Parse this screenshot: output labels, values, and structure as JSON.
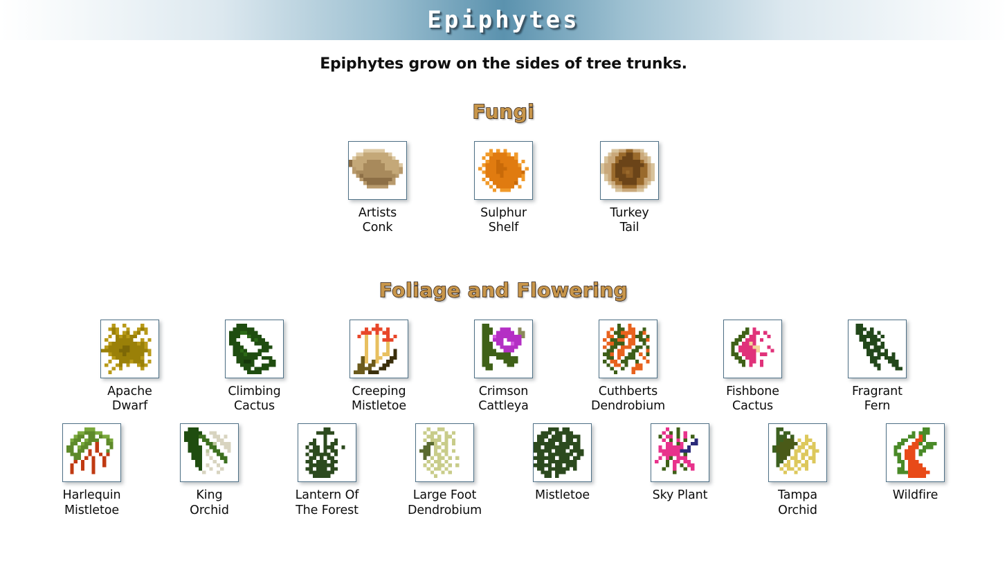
{
  "banner": {
    "title": "Epiphytes"
  },
  "subtitle": "Epiphytes grow on the sides of tree trunks.",
  "colors": {
    "banner_center": "#5b92ae",
    "banner_edge": "#ffffff",
    "heading_fill": "#c8964b",
    "heading_outline": "#201008",
    "icon_box_border": "#4d6f85",
    "icon_box_bg": "#ffffff",
    "label_text": "#0b0b0b"
  },
  "sections": [
    {
      "id": "fungi",
      "heading": "Fungi",
      "rows": [
        [
          {
            "label": "Artists\nConk",
            "icon": "artists-conk-icon"
          },
          {
            "label": "Sulphur\nShelf",
            "icon": "sulphur-shelf-icon"
          },
          {
            "label": "Turkey\nTail",
            "icon": "turkey-tail-icon"
          }
        ]
      ]
    },
    {
      "id": "foliage",
      "heading": "Foliage and Flowering",
      "rows": [
        [
          {
            "label": "Apache\nDwarf",
            "icon": "apache-dwarf-icon"
          },
          {
            "label": "Climbing\nCactus",
            "icon": "climbing-cactus-icon"
          },
          {
            "label": "Creeping\nMistletoe",
            "icon": "creeping-mistletoe-icon"
          },
          {
            "label": "Crimson\nCattleya",
            "icon": "crimson-cattleya-icon"
          },
          {
            "label": "Cuthberts\nDendrobium",
            "icon": "cuthberts-dendrobium-icon"
          },
          {
            "label": "Fishbone\nCactus",
            "icon": "fishbone-cactus-icon"
          },
          {
            "label": "Fragrant\nFern",
            "icon": "fragrant-fern-icon"
          }
        ],
        [
          {
            "label": "Harlequin\nMistletoe",
            "icon": "harlequin-mistletoe-icon"
          },
          {
            "label": "King\nOrchid",
            "icon": "king-orchid-icon"
          },
          {
            "label": "Lantern Of\nThe Forest",
            "icon": "lantern-of-the-forest-icon"
          },
          {
            "label": "Large Foot\nDendrobium",
            "icon": "large-foot-dendrobium-icon"
          },
          {
            "label": "Mistletoe",
            "icon": "mistletoe-icon"
          },
          {
            "label": "Sky Plant",
            "icon": "sky-plant-icon"
          },
          {
            "label": "Tampa\nOrchid",
            "icon": "tampa-orchid-icon"
          },
          {
            "label": "Wildfire",
            "icon": "wildfire-icon"
          }
        ]
      ]
    }
  ],
  "icon_art": {
    "artists-conk-icon": {
      "palette": {
        "a": "#c4a878",
        "b": "#a88a5c",
        "c": "#8d6f46",
        "d": "#ddc9a3",
        "e": "#b89a6c"
      },
      "rows": [
        "................",
        "................",
        "....dddddd......",
        "..ddaaaaaaad....",
        ".daaaaaaaaaad...",
        "caaaabbbbaaaaa..",
        "caaabbbbbbaaaad.",
        ".eaabbbbbbaaaae.",
        ".ebbbbbbbbbbaae.",
        "..ecbbbbbbbbbe..",
        "...ecccccccce...",
        "....eccccccee...",
        ".....eeeeee.....",
        "................",
        "................",
        "................"
      ]
    },
    "sulphur-shelf-icon": {
      "palette": {
        "o": "#e07b10",
        "p": "#f19a2a",
        "q": "#c96a08",
        "r": "#f6b860"
      },
      "rows": [
        "................",
        "................",
        "....p.p.p.......",
        "...ppoooop.p....",
        "..p.ooooooop....",
        "...pooqooooo.p..",
        "..poooqqoooop...",
        ".p.oooqqqoooo.p.",
        "..poooqqoooooq..",
        "...ooooqooooop..",
        "..p.oooooooo.p..",
        "...p.ooooooq....",
        "....p.ooooo.p...",
        ".....p.ppp......",
        "................",
        "................"
      ]
    },
    "turkey-tail-icon": {
      "palette": {
        "a": "#c9a87a",
        "b": "#9a6a2c",
        "c": "#6b4418",
        "d": "#d8c39c",
        "e": "#8a5a22"
      },
      "rows": [
        "................",
        "................",
        "...ddaabbaad....",
        "..daabbccbbad...",
        ".daabbcccbbaad..",
        ".daabccccccbad..",
        "daabccccccccbad.",
        "daabcceeeccbbad.",
        "daabccebeccbbad.",
        ".dabccceeccbbad.",
        ".dabbcccccbbaad.",
        "..dabbccccbbad..",
        "...daabbbbaad...",
        "....ddaaaadd....",
        "................",
        "................"
      ]
    },
    "apache-dwarf-icon": {
      "palette": {
        "y": "#9a8008",
        "z": "#b89a18",
        "w": "#7d6806"
      },
      "rows": [
        "................",
        "...z..z....z....",
        "..zyz..z..zyz...",
        "...yz.zy.zy.z...",
        "..z.yzyzyy......",
        ".z..yyyyy..z.z..",
        "..zyyyyyyyzyz...",
        ".zyyyywwyyyyz...",
        "yyyyywwwyyyyyz..",
        "..zyyywyyyyy.z..",
        "...zyyyyyyyz....",
        "..z..yyyzyyy.z..",
        ".z..zy.z..zyz...",
        "...z.z.....z....",
        "..z.............",
        "................"
      ]
    },
    "climbing-cactus-icon": {
      "palette": {
        "g": "#1f4d10",
        "h": "#2c6a17",
        "i": "#15380a"
      },
      "rows": [
        "................",
        "...ggg..........",
        "..gggggg........",
        ".ggghhggg.......",
        ".ggg..hggg......",
        ".gg....ghgg.....",
        ".ggg....gggg....",
        "..ggg.....ggg...",
        "..gghg...ggg....",
        "..ggghgggg......",
        "...gggggg.ggg...",
        "...ggiig....gg..",
        "....gggg..gggg..",
        ".....gg.gggg....",
        "......gggg......",
        "................"
      ]
    },
    "creeping-mistletoe-icon": {
      "palette": {
        "r": "#e8472a",
        "y": "#e8c060",
        "o": "#f07a33",
        "b": "#6b5a1c",
        "k": "#3a2f0c"
      },
      "rows": [
        "................",
        ".......r........",
        "....r.rrr.r.....",
        "...rrr.r.rr.....",
        "..r.y..y..r.r...",
        "....y..y.rrr....",
        "....y..y..y.....",
        "....y..y..y.....",
        "....y..y..y.k...",
        "....y..y.yy.k...",
        "...by..yy..kk...",
        "...by.by..kk....",
        "..bb.bb..kk.....",
        "..bbbb..kk......",
        ".bbb.kkk........",
        "................"
      ]
    },
    "crimson-cattleya-icon": {
      "palette": {
        "g": "#3f6118",
        "m": "#b42fc4",
        "n": "#d45ae0",
        "t": "#8a8a5a"
      },
      "rows": [
        "................",
        "..gg............",
        "..ggg..mmm..t...",
        "..ggg.mmmmm.tt..",
        "..gg.nmmmmmmmt..",
        "..gg.mmm.mmmm...",
        "..ggg.mm..nmm...",
        "..ggg..mmmmm....",
        "..gggg..mmm.....",
        "..gggggggg......",
        "..gg..gggggg....",
        "..gg....gggg....",
        "..ggg....gg.....",
        "...gg...........",
        "................",
        "................"
      ]
    },
    "cuthberts-dendrobium-icon": {
      "palette": {
        "o": "#e8621e",
        "g": "#3d5e18",
        "d": "#2b4410"
      },
      "rows": [
        "................",
        ".....g..o.......",
        "...o.gg.oo..g...",
        "..o.ggoooo.go...",
        "..oo.ggo.ogg.g..",
        ".o.ggoo.oo.ggo..",
        "..ooggg.oo..g...",
        ".o.gg.ooo.gg.g..",
        "..gg.oo..gg..o..",
        ".ggo.oo.gg.o.g..",
        "..gg.o.ggg..o...",
        ".g.oo.gg..g..o..",
        "..g.oo.g..oo....",
        "...g..g..ooo....",
        "....g....o......",
        "................"
      ]
    },
    "fishbone-cactus-icon": {
      "palette": {
        "p": "#e0327a",
        "q": "#f05d9a",
        "g": "#3f6118",
        "y": "#f2d69a"
      },
      "rows": [
        "................",
        "................",
        "......g.p.......",
        ".....gg.pp.p....",
        "....gg.pp...p...",
        "...gg.ppp.p.....",
        "..gg.ppyp.......",
        "..g.ppppyy..p...",
        "..g.pppppy...p..",
        "..gg.pppp.pp....",
        "...gg.ppp.......",
        "....gg.pp.p.....",
        ".....g.p..p.....",
        "................",
        "................",
        "................"
      ]
    },
    "fragrant-fern-icon": {
      "palette": {
        "g": "#22471a",
        "h": "#2f5f22"
      },
      "rows": [
        "................",
        "..gg............",
        "..ggg.g.........",
        "..gg.gg.g.......",
        "...ggggg.g......",
        "...gg.ggg.......",
        "....gggg.g......",
        "....gg.ggg......",
        ".....gggg.g.....",
        ".....gg.ggg.g...",
        "......ggg.ggg...",
        "......gg...ggg..",
        ".......gg...gg..",
        "........g....gg.",
        "................",
        "................"
      ]
    },
    "harlequin-mistletoe-icon": {
      "palette": {
        "g": "#5e8a2a",
        "h": "#7aa83c",
        "r": "#c03a12",
        "d": "#3f6118"
      },
      "rows": [
        "................",
        "......hhh.......",
        "....hhggghh.....",
        "...hgg.gg.ghh...",
        "..hgg.hggg..gh..",
        "..gg.hgg.r..gg..",
        ".gg.hgg..r...g..",
        ".gg.gg.r.r..g...",
        "..ggg..r..r.r...",
        "...gg.r.r..r....",
        "...r.r..r..r....",
        "..r..r..r..r....",
        "..r..r..r.......",
        "..r.....r.......",
        "................",
        "................"
      ]
    },
    "king-orchid-icon": {
      "palette": {
        "g": "#1f4d10",
        "h": "#3d7020",
        "c": "#d8d4c0",
        "e": "#b8c49a"
      },
      "rows": [
        "................",
        "..ggg...........",
        ".ggggg..cc......",
        ".gggghh..cc.c...",
        ".gggg.hh..cc....",
        "..ggg..hhe.ccc..",
        "..gggg..hh..cc..",
        "..gggg.e.hh..c..",
        "...ggg.c..hh....",
        "...ggg..c..hh...",
        "....gg...c..h...",
        "....gg.c..c.....",
        ".....g..c..c....",
        "......c...c.....",
        "................",
        "................"
      ]
    },
    "lantern-of-the-forest-icon": {
      "palette": {
        "g": "#2c4a1e",
        "h": "#3d6028"
      },
      "rows": [
        "................",
        ".......gg.......",
        ".....ggggg......",
        ".......g........",
        "....g..g..g.....",
        "...gg..g.gg.....",
        "..g.gg.ggg..g...",
        "...ggg.g.gg.....",
        "..g.ggggg.g.....",
        "...gg.g.gg......",
        "..gg.ggg.gg.....",
        "...ggggggg......",
        "..gg.ggg.gg.....",
        "...ggggggg......",
        "....ggggg.......",
        "................"
      ]
    },
    "large-foot-dendrobium-icon": {
      "palette": {
        "y": "#c8cc8a",
        "g": "#5a6b30",
        "d": "#3f4a1c"
      },
      "rows": [
        "................",
        "...y..yy........",
        "..y.yy..y.y.....",
        "...yy.y.yy......",
        "..y.yyy.y.y.....",
        "...ggy.yy.y.....",
        "..gg.yy.y.......",
        ".ggg.y.yy.y.....",
        "..gg.yy.y.......",
        "..g.y.yy.y.y....",
        "...y.yy.y.......",
        "..y.y.yy.y.y....",
        "...y.yy.y.......",
        "....y..y.y......",
        ".....y..........",
        "................"
      ]
    },
    "mistletoe-icon": {
      "palette": {
        "g": "#2c4a1e",
        "h": "#3a5c26"
      },
      "rows": [
        "................",
        "....ggg.gg......",
        "..ggg.ggggg.....",
        ".ggg.ggg.gggg...",
        ".gg.gggg.gg.g...",
        "gggggg.gggggg...",
        "gg.ggggggg.gg...",
        "ggggg.ggg.gggg..",
        ".gg.ggggggg.gg..",
        "gggggg.ggg.gg...",
        ".gg.gggggggg....",
        "ggggg.gg.ggg....",
        ".gg.gggggg.g....",
        "..ggg.ggg.......",
        "...gg.g.........",
        "................"
      ]
    },
    "sky-plant-icon": {
      "palette": {
        "p": "#e8328c",
        "g": "#3f6118",
        "b": "#2a2a7a"
      },
      "rows": [
        "................",
        "....p..g........",
        "...p.g.g.p......",
        "..g.pp.g.p.g....",
        "...p.g.p.g..b...",
        "....pp.gp..bb...",
        "..p.ppppp.b.....",
        "..ppppppbbb.....",
        "...ppppp.g......",
        "..p.pg.ppp......",
        ".p..g.pp.pp.....",
        "....g.p.g.pp....",
        "...g..p..g.p....",
        "......g.........",
        "................",
        "................"
      ]
    },
    "tampa-orchid-icon": {
      "palette": {
        "g": "#3d6020",
        "d": "#4a5a18",
        "y": "#ddc85c"
      },
      "rows": [
        "................",
        "..gg............",
        "..g.gg..........",
        "..ggg.g...y.....",
        "..ggddd.y.yy....",
        "..gddddd.yy.y...",
        ".gddddd.yy.yy...",
        ".gdddd.yy.y.yy..",
        "..gddd.y.yy.y...",
        "..gdd.yy.y.yy...",
        "..gg.y.yy.y.y...",
        "..g.yy.y.yy.....",
        "...y.yy.y.y.....",
        "....y..y........",
        "................",
        "................"
      ]
    },
    "wildfire-icon": {
      "palette": {
        "g": "#4a8a28",
        "o": "#e84a18",
        "h": "#5fa832"
      },
      "rows": [
        "................",
        "..........gg....",
        ".......g.ggg....",
        "......gg.og.....",
        "....gg..oog.....",
        "...gg..oog.ggg..",
        "..gg..ooo.ggg...",
        "..g..ooo.gg.....",
        "..gg.ooo.g......",
        "...g.ooo........",
        "...gg.ooo.......",
        "....g.oooo......",
        "...gg.ooooo.....",
        "...gggoooooo....",
        "......ooooo.....",
        "................"
      ]
    }
  }
}
